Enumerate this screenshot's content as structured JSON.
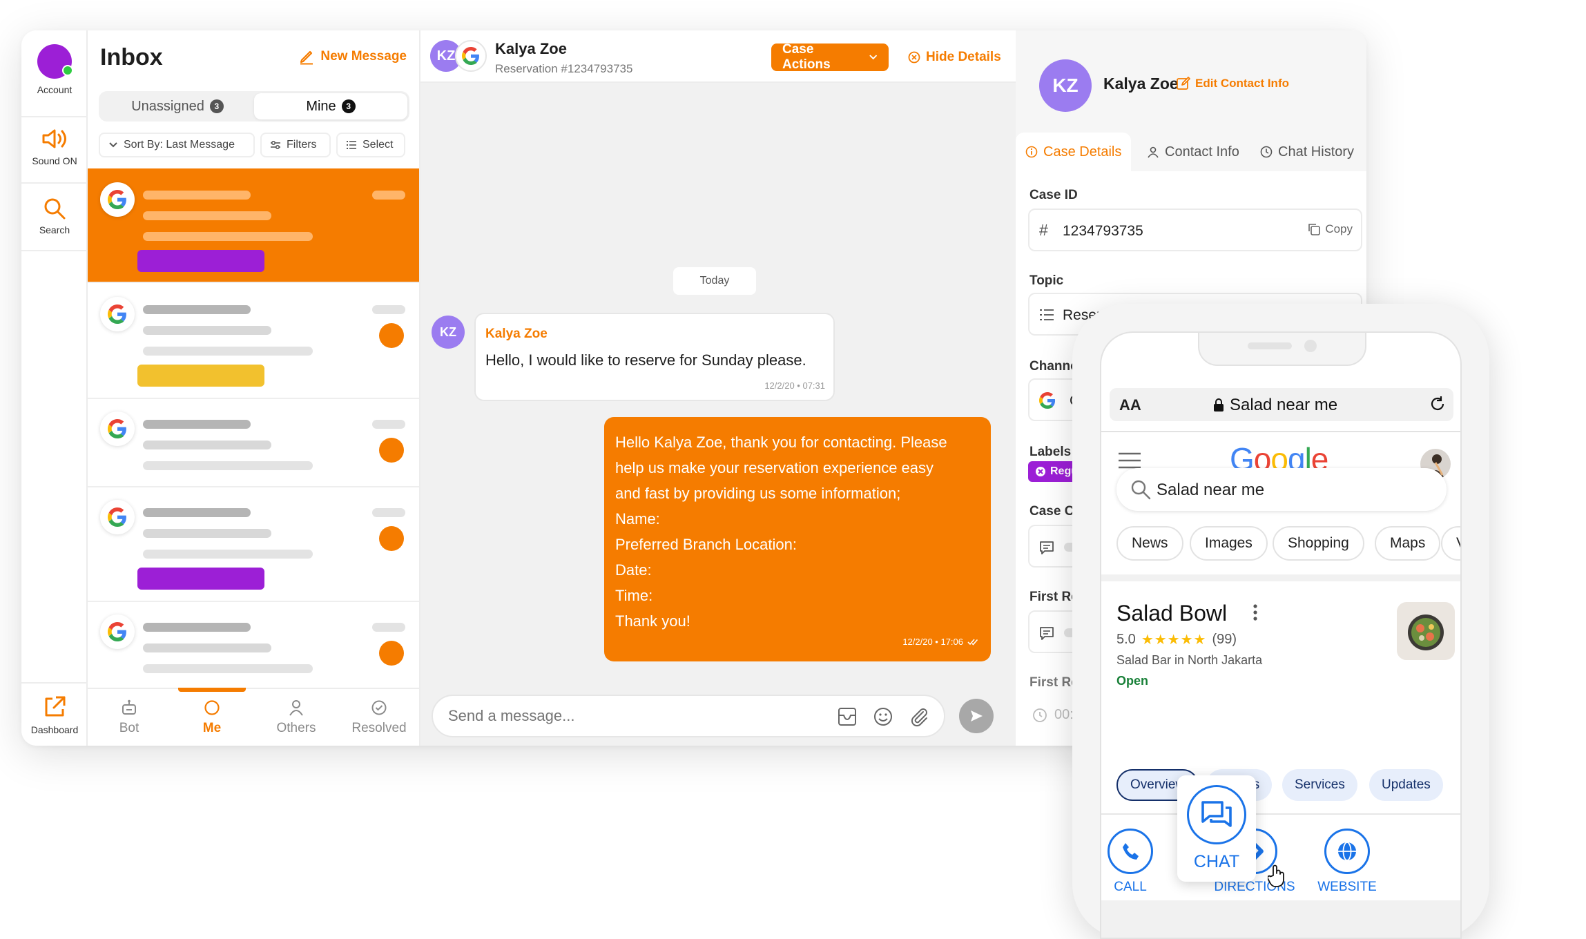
{
  "rail": {
    "account_label": "Account",
    "sound_label": "Sound ON",
    "search_label": "Search",
    "dashboard_label": "Dashboard"
  },
  "inbox": {
    "title": "Inbox",
    "new_message": "New Message",
    "tabs": [
      {
        "label": "Unassigned",
        "count": "3"
      },
      {
        "label": "Mine",
        "count": "3"
      }
    ],
    "sort_label": "Sort By: Last Message",
    "filters_label": "Filters",
    "select_label": "Select",
    "bottom_nav": [
      {
        "label": "Bot"
      },
      {
        "label": "Me"
      },
      {
        "label": "Others"
      },
      {
        "label": "Resolved"
      }
    ]
  },
  "chat": {
    "contact_name": "Kalya Zoe",
    "initials": "KZ",
    "reservation": "Reservation #1234793735",
    "case_actions": "Case Actions",
    "hide_details": "Hide Details",
    "day_divider": "Today",
    "incoming": {
      "sender": "Kalya Zoe",
      "text": "Hello, I would like to reserve for Sunday please.",
      "time": "12/2/20 • 07:31"
    },
    "outgoing": {
      "lines": [
        "Hello Kalya Zoe, thank you for contacting. Please",
        "help us make your reservation experience easy",
        "and fast by providing us some information;",
        "Name:",
        "Preferred Branch Location:",
        "Date:",
        "Time:",
        "Thank you!"
      ],
      "time": "12/2/20 • 17:06"
    },
    "composer_placeholder": "Send a message..."
  },
  "details": {
    "name": "Kalya Zoe",
    "initials": "KZ",
    "edit_contact": "Edit Contact Info",
    "tabs": [
      "Case Details",
      "Contact Info",
      "Chat History"
    ],
    "case_id_label": "Case ID",
    "case_id_value": "1234793735",
    "copy_label": "Copy",
    "topic_label": "Topic",
    "topic_value": "Reserv",
    "channel_label": "Channel",
    "channel_value": "Go",
    "labels_label": "Labels",
    "label_chip": "Regul",
    "case_created_label": "Case Cre",
    "first_res_label_1": "First Res",
    "first_res_label_2": "First Res",
    "first_res_time": "00:"
  },
  "phone": {
    "aa": "AA",
    "url_text": "Salad near me",
    "google": [
      "G",
      "o",
      "o",
      "g",
      "l",
      "e"
    ],
    "google_colors": [
      "#4285F4",
      "#EA4335",
      "#FBBC05",
      "#4285F4",
      "#34A853",
      "#EA4335"
    ],
    "search_value": "Salad near me",
    "chips": [
      "News",
      "Images",
      "Shopping",
      "Maps",
      "V"
    ],
    "business": {
      "name": "Salad Bowl",
      "rating": "5.0",
      "stars": "★★★★★",
      "reviews": "(99)",
      "category": "Salad Bar in North Jakarta",
      "status": "Open"
    },
    "biz_tabs": [
      "Overview",
      "Photos",
      "Services",
      "Updates"
    ],
    "actions": [
      "CALL",
      "CHAT",
      "DIRECTIONS",
      "WEBSITE"
    ]
  },
  "colors": {
    "accent": "#f57c00",
    "purple": "#9c1fd6",
    "yellow": "#f2c12e",
    "avatar": "#9b7cf0",
    "google_blue": "#1a73e8"
  }
}
